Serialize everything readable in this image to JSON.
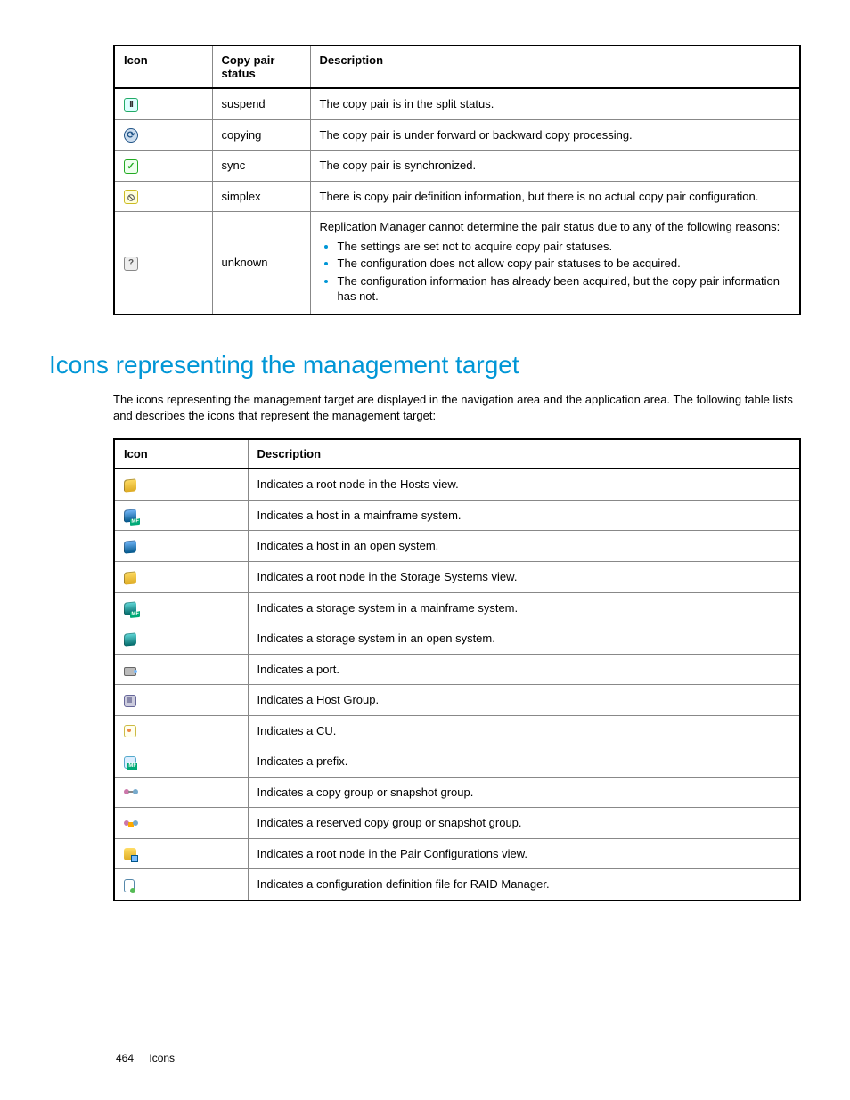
{
  "table1": {
    "headers": [
      "Icon",
      "Copy pair status",
      "Description"
    ],
    "rows": [
      {
        "status": "suspend",
        "desc": "The copy pair is in the split status."
      },
      {
        "status": "copying",
        "desc": "The copy pair is under forward or backward copy processing."
      },
      {
        "status": "sync",
        "desc": "The copy pair is synchronized."
      },
      {
        "status": "simplex",
        "desc": "There is copy pair definition information, but there is no actual copy pair configuration."
      },
      {
        "status": "unknown",
        "desc_intro": "Replication Manager cannot determine the pair status due to any of the following reasons:",
        "reasons": [
          "The settings are set not to acquire copy pair statuses.",
          "The configuration does not allow copy pair statuses to be acquired.",
          "The configuration information has already been acquired, but the copy pair information has not."
        ]
      }
    ]
  },
  "section2": {
    "heading": "Icons representing the management target",
    "intro": "The icons representing the management target are displayed in the navigation area and the application area. The following table lists and describes the icons that represent the management target:"
  },
  "table2": {
    "headers": [
      "Icon",
      "Description"
    ],
    "rows": [
      {
        "desc": "Indicates a root node in the Hosts view."
      },
      {
        "desc": "Indicates a host in a mainframe system."
      },
      {
        "desc": "Indicates a host in an open system."
      },
      {
        "desc": "Indicates a root node in the Storage Systems view."
      },
      {
        "desc": "Indicates a storage system in a mainframe system."
      },
      {
        "desc": "Indicates a storage system in an open system."
      },
      {
        "desc": "Indicates a port."
      },
      {
        "desc": "Indicates a Host Group."
      },
      {
        "desc": "Indicates a CU."
      },
      {
        "desc": "Indicates a prefix."
      },
      {
        "desc": "Indicates a copy group or snapshot group."
      },
      {
        "desc": "Indicates a reserved copy group or snapshot group."
      },
      {
        "desc": "Indicates a root node in the Pair Configurations view."
      },
      {
        "desc": "Indicates a configuration definition file for RAID Manager."
      }
    ]
  },
  "footer": {
    "page": "464",
    "section": "Icons"
  }
}
